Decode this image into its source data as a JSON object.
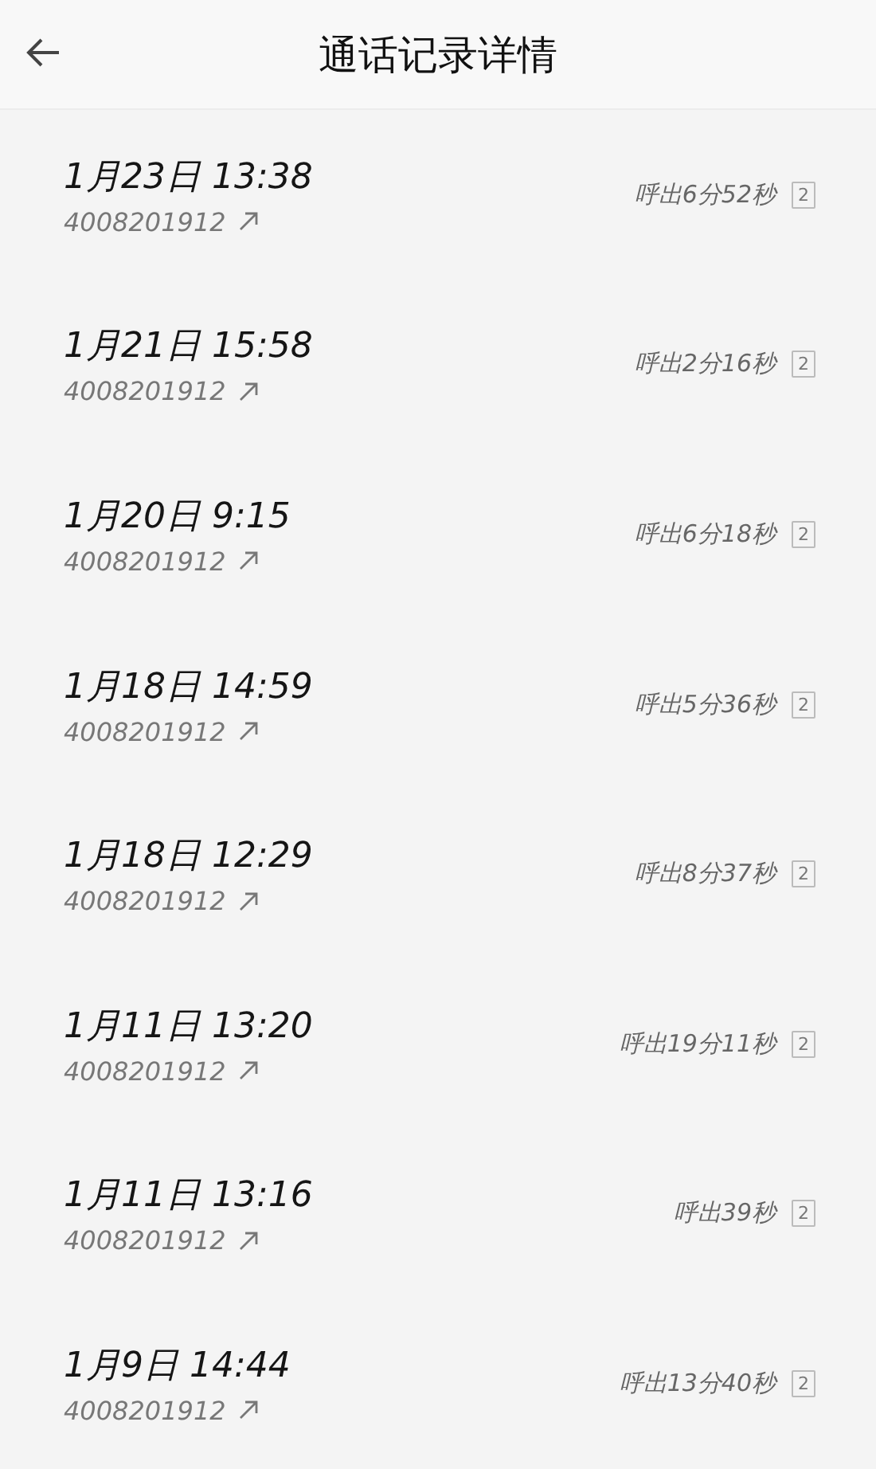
{
  "header": {
    "title": "通话记录详情"
  },
  "calls": [
    {
      "datetime": "1月23日 13:38",
      "number": "4008201912",
      "summary": "呼出6分52秒",
      "sim": "2"
    },
    {
      "datetime": "1月21日 15:58",
      "number": "4008201912",
      "summary": "呼出2分16秒",
      "sim": "2"
    },
    {
      "datetime": "1月20日 9:15",
      "number": "4008201912",
      "summary": "呼出6分18秒",
      "sim": "2"
    },
    {
      "datetime": "1月18日 14:59",
      "number": "4008201912",
      "summary": "呼出5分36秒",
      "sim": "2"
    },
    {
      "datetime": "1月18日 12:29",
      "number": "4008201912",
      "summary": "呼出8分37秒",
      "sim": "2"
    },
    {
      "datetime": "1月11日 13:20",
      "number": "4008201912",
      "summary": "呼出19分11秒",
      "sim": "2"
    },
    {
      "datetime": "1月11日 13:16",
      "number": "4008201912",
      "summary": "呼出39秒",
      "sim": "2"
    },
    {
      "datetime": "1月9日 14:44",
      "number": "4008201912",
      "summary": "呼出13分40秒",
      "sim": "2"
    }
  ]
}
